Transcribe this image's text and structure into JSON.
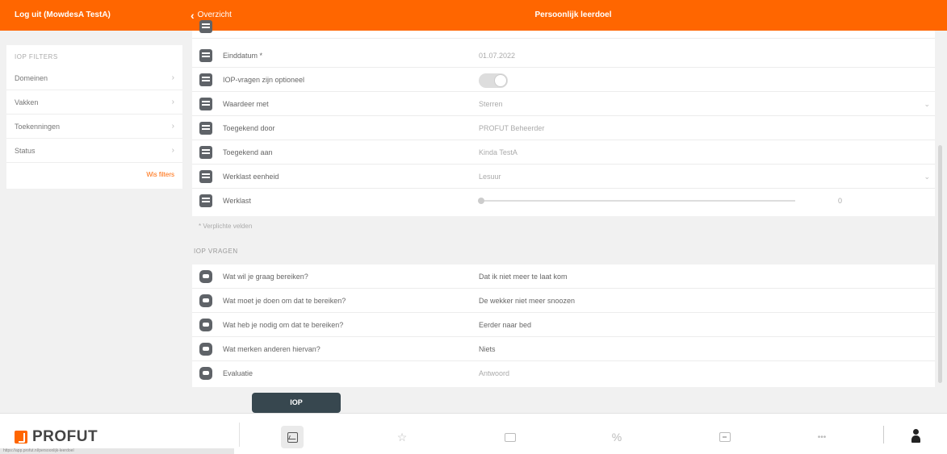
{
  "topbar": {
    "logout": "Log uit (MowdesA TestA)",
    "back": "Overzicht",
    "title": "Persoonlijk leerdoel"
  },
  "filters": {
    "heading": "IOP FILTERS",
    "items": [
      {
        "label": "Domeinen"
      },
      {
        "label": "Vakken"
      },
      {
        "label": "Toekenningen"
      },
      {
        "label": "Status"
      }
    ],
    "more": "Wis filters"
  },
  "form": {
    "rows": [
      {
        "label": "Einddatum *",
        "value": "01.07.2022",
        "icon": "calendar-icon"
      },
      {
        "label": "IOP-vragen zijn optioneel",
        "value": "",
        "icon": "toggle-icon",
        "toggle_on": false
      },
      {
        "label": "Waardeer met",
        "value": "Sterren",
        "icon": "list-icon"
      },
      {
        "label": "Toegekend door",
        "value": "PROFUT Beheerder",
        "icon": "contact-icon"
      },
      {
        "label": "Toegekend aan",
        "value": "Kinda TestA",
        "icon": "contact-icon"
      },
      {
        "label": "Werklast eenheid",
        "value": "Lesuur",
        "icon": "list-icon"
      },
      {
        "label": "Werklast",
        "value": "0",
        "icon": "list-icon"
      }
    ],
    "required_note": "* Verplichte velden"
  },
  "questions": {
    "heading": "IOP VRAGEN",
    "items": [
      {
        "question": "Wat wil je graag bereiken?",
        "answer": "Dat ik niet meer te laat kom"
      },
      {
        "question": "Wat moet je doen om dat te bereiken?",
        "answer": "De wekker niet meer snoozen"
      },
      {
        "question": "Wat heb je nodig om dat te bereiken?",
        "answer": "Eerder naar bed"
      },
      {
        "question": "Wat merken anderen hiervan?",
        "answer": "Niets"
      },
      {
        "question": "Evaluatie",
        "answer": "Antwoord"
      }
    ]
  },
  "bottombar": {
    "logo": "PROFUT",
    "tooltip": "IOP",
    "status_url": "https://app.profut.nl/persoonlijk-leerdoel",
    "nav": [
      "chart-icon",
      "star-icon",
      "folder-icon",
      "percent-icon",
      "briefcase-icon",
      "more-icon",
      "user-icon"
    ],
    "more_label": "•••"
  },
  "colors": {
    "accent": "#ff6600",
    "tooltip": "#37474f"
  }
}
